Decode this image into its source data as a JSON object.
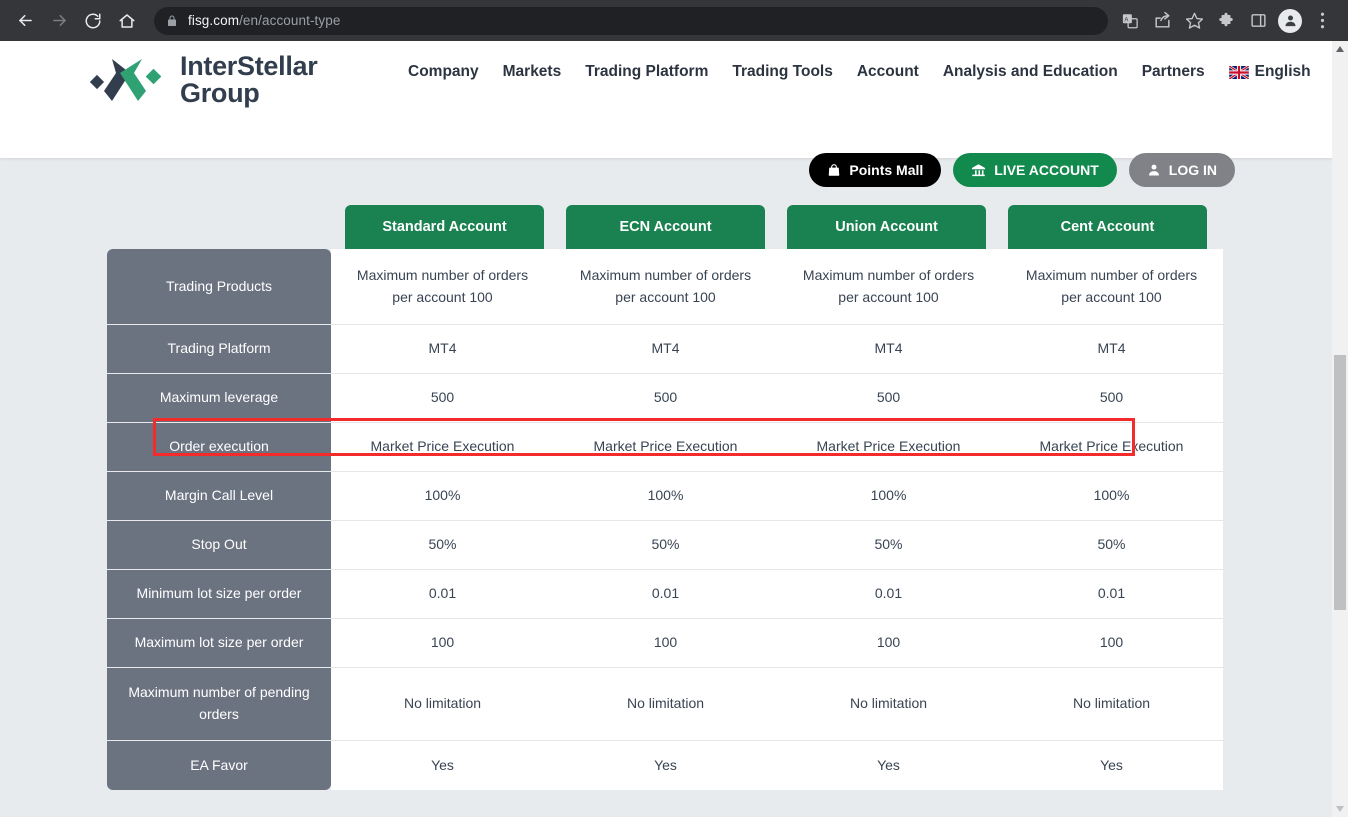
{
  "browser": {
    "url_host": "fisg.com",
    "url_path": "/en/account-type",
    "back_icon": "back-arrow-icon",
    "forward_icon": "forward-arrow-icon",
    "reload_icon": "reload-icon",
    "home_icon": "home-icon",
    "lock_icon": "lock-icon",
    "translate_icon": "translate-icon",
    "share_icon": "share-icon",
    "bookmark_icon": "star-icon",
    "extensions_icon": "puzzle-icon",
    "sidepanel_icon": "side-panel-icon",
    "profile_icon": "profile-avatar-icon",
    "menu_icon": "three-dot-menu-icon"
  },
  "site": {
    "logo_line1": "InterStellar",
    "logo_line2": "Group",
    "nav": [
      {
        "label": "Company"
      },
      {
        "label": "Markets"
      },
      {
        "label": "Trading Platform"
      },
      {
        "label": "Trading Tools"
      },
      {
        "label": "Account"
      },
      {
        "label": "Analysis and Education"
      },
      {
        "label": "Partners"
      }
    ],
    "language": "English",
    "buttons": {
      "points_mall": "Points Mall",
      "live_account": "LIVE ACCOUNT",
      "log_in": "LOG IN"
    }
  },
  "table": {
    "columns": [
      "Standard Account",
      "ECN Account",
      "Union Account",
      "Cent Account"
    ],
    "rows": [
      {
        "label": "Trading Products",
        "values": [
          "Maximum number of orders per account 100",
          "Maximum number of orders per account 100",
          "Maximum number of orders per account 100",
          "Maximum number of orders per account 100"
        ]
      },
      {
        "label": "Trading Platform",
        "values": [
          "MT4",
          "MT4",
          "MT4",
          "MT4"
        ]
      },
      {
        "label": "Maximum leverage",
        "values": [
          "500",
          "500",
          "500",
          "500"
        ],
        "highlighted": true
      },
      {
        "label": "Order execution",
        "values": [
          "Market Price Execution",
          "Market Price Execution",
          "Market Price Execution",
          "Market Price Execution"
        ]
      },
      {
        "label": "Margin Call Level",
        "values": [
          "100%",
          "100%",
          "100%",
          "100%"
        ]
      },
      {
        "label": "Stop Out",
        "values": [
          "50%",
          "50%",
          "50%",
          "50%"
        ]
      },
      {
        "label": "Minimum lot size per order",
        "values": [
          "0.01",
          "0.01",
          "0.01",
          "0.01"
        ]
      },
      {
        "label": "Maximum lot size per order",
        "values": [
          "100",
          "100",
          "100",
          "100"
        ]
      },
      {
        "label": "Maximum number of pending orders",
        "values": [
          "No limitation",
          "No limitation",
          "No limitation",
          "No limitation"
        ]
      },
      {
        "label": "EA Favor",
        "values": [
          "Yes",
          "Yes",
          "Yes",
          "Yes"
        ]
      }
    ]
  },
  "annotation": {
    "highlight_color": "#f42b2b",
    "highlight_row": "Maximum leverage"
  },
  "colors": {
    "brand_green": "#1a8150",
    "row_label_gray": "#6b7280",
    "page_bg": "#e8ebee",
    "logo_dark": "#323e4e"
  }
}
